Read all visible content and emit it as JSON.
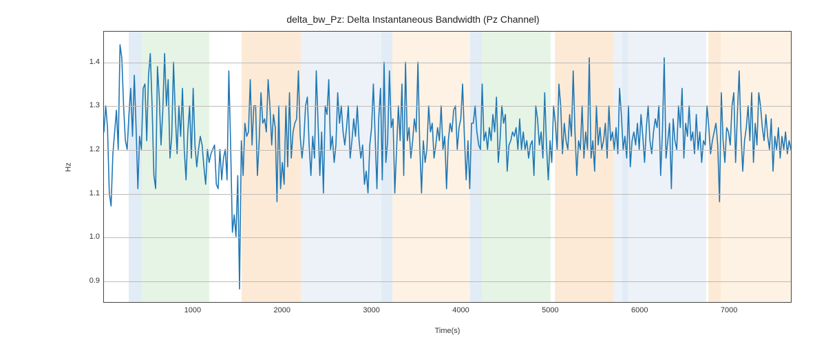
{
  "chart_data": {
    "type": "line",
    "title": "delta_bw_Pz: Delta Instantaneous Bandwidth (Pz Channel)",
    "xlabel": "Time(s)",
    "ylabel": "Hz",
    "xlim": [
      0,
      7700
    ],
    "ylim": [
      0.85,
      1.47
    ],
    "xticks": [
      1000,
      2000,
      3000,
      4000,
      5000,
      6000,
      7000
    ],
    "yticks": [
      0.9,
      1.0,
      1.1,
      1.2,
      1.3,
      1.4
    ],
    "grid": true,
    "line_color": "#1f77b4",
    "bands": [
      {
        "x0": 280,
        "x1": 420,
        "color": "#a9c8e5"
      },
      {
        "x0": 420,
        "x1": 1180,
        "color": "#b8e0b8"
      },
      {
        "x0": 1540,
        "x1": 2200,
        "color": "#f9c48a"
      },
      {
        "x0": 2200,
        "x1": 3100,
        "color": "#c9d9e8"
      },
      {
        "x0": 3100,
        "x1": 3230,
        "color": "#a9c8e5"
      },
      {
        "x0": 3230,
        "x1": 4100,
        "color": "#fdd9b3"
      },
      {
        "x0": 4100,
        "x1": 4230,
        "color": "#a9c8e5"
      },
      {
        "x0": 4230,
        "x1": 5000,
        "color": "#b8e0b8"
      },
      {
        "x0": 5040,
        "x1": 5700,
        "color": "#f9c48a"
      },
      {
        "x0": 5700,
        "x1": 5800,
        "color": "#c9d9e8"
      },
      {
        "x0": 5800,
        "x1": 5860,
        "color": "#a9c8e5"
      },
      {
        "x0": 5860,
        "x1": 6740,
        "color": "#c9d9e8"
      },
      {
        "x0": 6760,
        "x1": 6900,
        "color": "#f9c48a"
      },
      {
        "x0": 6900,
        "x1": 7700,
        "color": "#fdd9b3"
      }
    ],
    "x": [
      0,
      20,
      40,
      60,
      80,
      100,
      120,
      140,
      160,
      180,
      200,
      220,
      240,
      260,
      280,
      300,
      320,
      340,
      360,
      380,
      400,
      420,
      440,
      460,
      480,
      500,
      520,
      540,
      560,
      580,
      600,
      620,
      640,
      660,
      680,
      700,
      720,
      740,
      760,
      780,
      800,
      820,
      840,
      860,
      880,
      900,
      920,
      940,
      960,
      980,
      1000,
      1020,
      1040,
      1060,
      1080,
      1100,
      1120,
      1140,
      1160,
      1180,
      1200,
      1220,
      1240,
      1260,
      1280,
      1300,
      1320,
      1340,
      1360,
      1380,
      1400,
      1420,
      1440,
      1460,
      1480,
      1500,
      1520,
      1540,
      1560,
      1580,
      1600,
      1620,
      1640,
      1660,
      1680,
      1700,
      1720,
      1740,
      1760,
      1780,
      1800,
      1820,
      1840,
      1860,
      1880,
      1900,
      1920,
      1940,
      1960,
      1980,
      2000,
      2020,
      2040,
      2060,
      2080,
      2100,
      2120,
      2140,
      2160,
      2180,
      2200,
      2220,
      2240,
      2260,
      2280,
      2300,
      2320,
      2340,
      2360,
      2380,
      2400,
      2420,
      2440,
      2460,
      2480,
      2500,
      2520,
      2540,
      2560,
      2580,
      2600,
      2620,
      2640,
      2660,
      2680,
      2700,
      2720,
      2740,
      2760,
      2780,
      2800,
      2820,
      2840,
      2860,
      2880,
      2900,
      2920,
      2940,
      2960,
      2980,
      3000,
      3020,
      3040,
      3060,
      3080,
      3100,
      3120,
      3140,
      3160,
      3180,
      3200,
      3220,
      3240,
      3260,
      3280,
      3300,
      3320,
      3340,
      3360,
      3380,
      3400,
      3420,
      3440,
      3460,
      3480,
      3500,
      3520,
      3540,
      3560,
      3580,
      3600,
      3620,
      3640,
      3660,
      3680,
      3700,
      3720,
      3740,
      3760,
      3780,
      3800,
      3820,
      3840,
      3860,
      3880,
      3900,
      3920,
      3940,
      3960,
      3980,
      4000,
      4020,
      4040,
      4060,
      4080,
      4100,
      4120,
      4140,
      4160,
      4180,
      4200,
      4220,
      4240,
      4260,
      4280,
      4300,
      4320,
      4340,
      4360,
      4380,
      4400,
      4420,
      4440,
      4460,
      4480,
      4500,
      4520,
      4540,
      4560,
      4580,
      4600,
      4620,
      4640,
      4660,
      4680,
      4700,
      4720,
      4740,
      4760,
      4780,
      4800,
      4820,
      4840,
      4860,
      4880,
      4900,
      4920,
      4940,
      4960,
      4980,
      5000,
      5020,
      5040,
      5060,
      5080,
      5100,
      5120,
      5140,
      5160,
      5180,
      5200,
      5220,
      5240,
      5260,
      5280,
      5300,
      5320,
      5340,
      5360,
      5380,
      5400,
      5420,
      5440,
      5460,
      5480,
      5500,
      5520,
      5540,
      5560,
      5580,
      5600,
      5620,
      5640,
      5660,
      5680,
      5700,
      5720,
      5740,
      5760,
      5780,
      5800,
      5820,
      5840,
      5860,
      5880,
      5900,
      5920,
      5940,
      5960,
      5980,
      6000,
      6020,
      6040,
      6060,
      6080,
      6100,
      6120,
      6140,
      6160,
      6180,
      6200,
      6220,
      6240,
      6260,
      6280,
      6300,
      6320,
      6340,
      6360,
      6380,
      6400,
      6420,
      6440,
      6460,
      6480,
      6500,
      6520,
      6540,
      6560,
      6580,
      6600,
      6620,
      6640,
      6660,
      6680,
      6700,
      6720,
      6740,
      6760,
      6780,
      6800,
      6820,
      6840,
      6860,
      6880,
      6900,
      6920,
      6940,
      6960,
      6980,
      7000,
      7020,
      7040,
      7060,
      7080,
      7100,
      7120,
      7140,
      7160,
      7180,
      7200,
      7220,
      7240,
      7260,
      7280,
      7300,
      7320,
      7340,
      7360,
      7380,
      7400,
      7420,
      7440,
      7460,
      7480,
      7500,
      7520,
      7540,
      7560,
      7580,
      7600,
      7620,
      7640,
      7660,
      7680,
      7700
    ],
    "values": [
      1.24,
      1.3,
      1.25,
      1.1,
      1.07,
      1.19,
      1.24,
      1.29,
      1.2,
      1.44,
      1.41,
      1.3,
      1.22,
      1.2,
      1.28,
      1.34,
      1.23,
      1.37,
      1.25,
      1.11,
      1.23,
      1.2,
      1.34,
      1.35,
      1.22,
      1.37,
      1.42,
      1.3,
      1.14,
      1.11,
      1.39,
      1.32,
      1.21,
      1.29,
      1.42,
      1.3,
      1.36,
      1.18,
      1.23,
      1.4,
      1.28,
      1.19,
      1.3,
      1.23,
      1.34,
      1.2,
      1.13,
      1.24,
      1.3,
      1.18,
      1.34,
      1.21,
      1.16,
      1.2,
      1.23,
      1.21,
      1.16,
      1.12,
      1.2,
      1.17,
      1.19,
      1.2,
      1.21,
      1.12,
      1.11,
      1.2,
      1.13,
      1.18,
      1.2,
      1.13,
      1.38,
      1.21,
      1.01,
      1.05,
      1.0,
      1.14,
      0.88,
      1.22,
      1.14,
      1.26,
      1.23,
      1.24,
      1.36,
      1.21,
      1.3,
      1.3,
      1.14,
      1.22,
      1.33,
      1.26,
      1.27,
      1.24,
      1.36,
      1.3,
      1.21,
      1.28,
      1.25,
      1.08,
      1.3,
      1.11,
      1.17,
      1.12,
      1.3,
      1.16,
      1.33,
      1.18,
      1.24,
      1.26,
      1.27,
      1.38,
      1.23,
      1.18,
      1.22,
      1.3,
      1.32,
      1.21,
      1.14,
      1.23,
      1.18,
      1.38,
      1.26,
      1.14,
      1.24,
      1.1,
      1.3,
      1.28,
      1.36,
      1.2,
      1.23,
      1.17,
      1.21,
      1.33,
      1.26,
      1.3,
      1.24,
      1.21,
      1.25,
      1.3,
      1.18,
      1.22,
      1.27,
      1.23,
      1.3,
      1.22,
      1.18,
      1.21,
      1.12,
      1.15,
      1.1,
      1.21,
      1.25,
      1.35,
      1.23,
      1.11,
      1.27,
      1.34,
      1.13,
      1.4,
      1.17,
      1.22,
      1.38,
      1.25,
      1.27,
      1.1,
      1.2,
      1.3,
      1.22,
      1.35,
      1.14,
      1.4,
      1.22,
      1.25,
      1.18,
      1.22,
      1.27,
      1.24,
      1.4,
      1.21,
      1.1,
      1.22,
      1.17,
      1.2,
      1.3,
      1.24,
      1.26,
      1.18,
      1.21,
      1.25,
      1.22,
      1.3,
      1.2,
      1.23,
      1.11,
      1.22,
      1.26,
      1.24,
      1.29,
      1.3,
      1.2,
      1.25,
      1.27,
      1.35,
      1.23,
      1.13,
      1.22,
      1.11,
      1.26,
      1.26,
      1.3,
      1.24,
      1.21,
      1.2,
      1.35,
      1.22,
      1.24,
      1.2,
      1.25,
      1.22,
      1.28,
      1.24,
      1.32,
      1.17,
      1.22,
      1.3,
      1.26,
      1.28,
      1.15,
      1.21,
      1.22,
      1.24,
      1.23,
      1.25,
      1.2,
      1.27,
      1.2,
      1.24,
      1.2,
      1.22,
      1.18,
      1.21,
      1.22,
      1.14,
      1.3,
      1.27,
      1.21,
      1.24,
      1.18,
      1.33,
      1.21,
      1.13,
      1.22,
      1.17,
      1.3,
      1.26,
      1.2,
      1.35,
      1.3,
      1.19,
      1.26,
      1.22,
      1.2,
      1.28,
      1.23,
      1.38,
      1.24,
      1.14,
      1.22,
      1.2,
      1.3,
      1.18,
      1.24,
      1.2,
      1.41,
      1.18,
      1.22,
      1.15,
      1.3,
      1.21,
      1.25,
      1.2,
      1.22,
      1.26,
      1.18,
      1.3,
      1.22,
      1.24,
      1.2,
      1.25,
      1.19,
      1.34,
      1.28,
      1.2,
      1.23,
      1.18,
      1.3,
      1.16,
      1.22,
      1.24,
      1.21,
      1.26,
      1.2,
      1.28,
      1.23,
      1.17,
      1.25,
      1.3,
      1.22,
      1.19,
      1.24,
      1.27,
      1.25,
      1.3,
      1.14,
      1.24,
      1.41,
      1.18,
      1.22,
      1.26,
      1.11,
      1.27,
      1.22,
      1.2,
      1.3,
      1.25,
      1.34,
      1.18,
      1.26,
      1.23,
      1.3,
      1.22,
      1.24,
      1.19,
      1.28,
      1.2,
      1.24,
      1.17,
      1.22,
      1.21,
      1.3,
      1.25,
      1.19,
      1.22,
      1.24,
      1.26,
      1.21,
      1.08,
      1.33,
      1.22,
      1.17,
      1.25,
      1.24,
      1.21,
      1.3,
      1.33,
      1.17,
      1.28,
      1.38,
      1.24,
      1.15,
      1.22,
      1.25,
      1.3,
      1.22,
      1.33,
      1.17,
      1.26,
      1.21,
      1.33,
      1.3,
      1.25,
      1.22,
      1.28,
      1.23,
      1.2,
      1.27,
      1.15,
      1.23,
      1.2,
      1.25,
      1.18,
      1.23,
      1.2,
      1.24,
      1.19,
      1.22,
      1.2
    ]
  }
}
